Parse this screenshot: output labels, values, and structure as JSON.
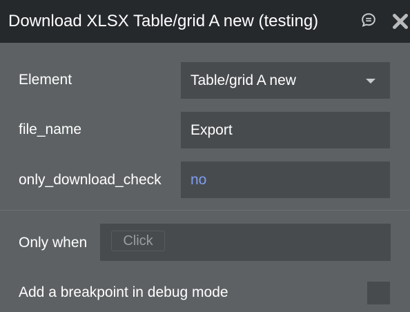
{
  "header": {
    "title": "Download XLSX Table/grid A new (testing)",
    "icons": [
      "comment-icon",
      "close-icon"
    ]
  },
  "fields": {
    "element": {
      "label": "Element",
      "value": "Table/grid A new"
    },
    "file_name": {
      "label": "file_name",
      "value": "Export"
    },
    "only_download_check": {
      "label": "only_download_check",
      "value": "no"
    }
  },
  "condition": {
    "label": "Only when",
    "chip_label": "Click"
  },
  "breakpoint": {
    "label": "Add a breakpoint in debug mode",
    "checked": false
  },
  "colors": {
    "header_background": "#26292c",
    "panel_background": "#5d6163",
    "field_background": "#484b4e",
    "value_accent": "#7e9ef0"
  }
}
